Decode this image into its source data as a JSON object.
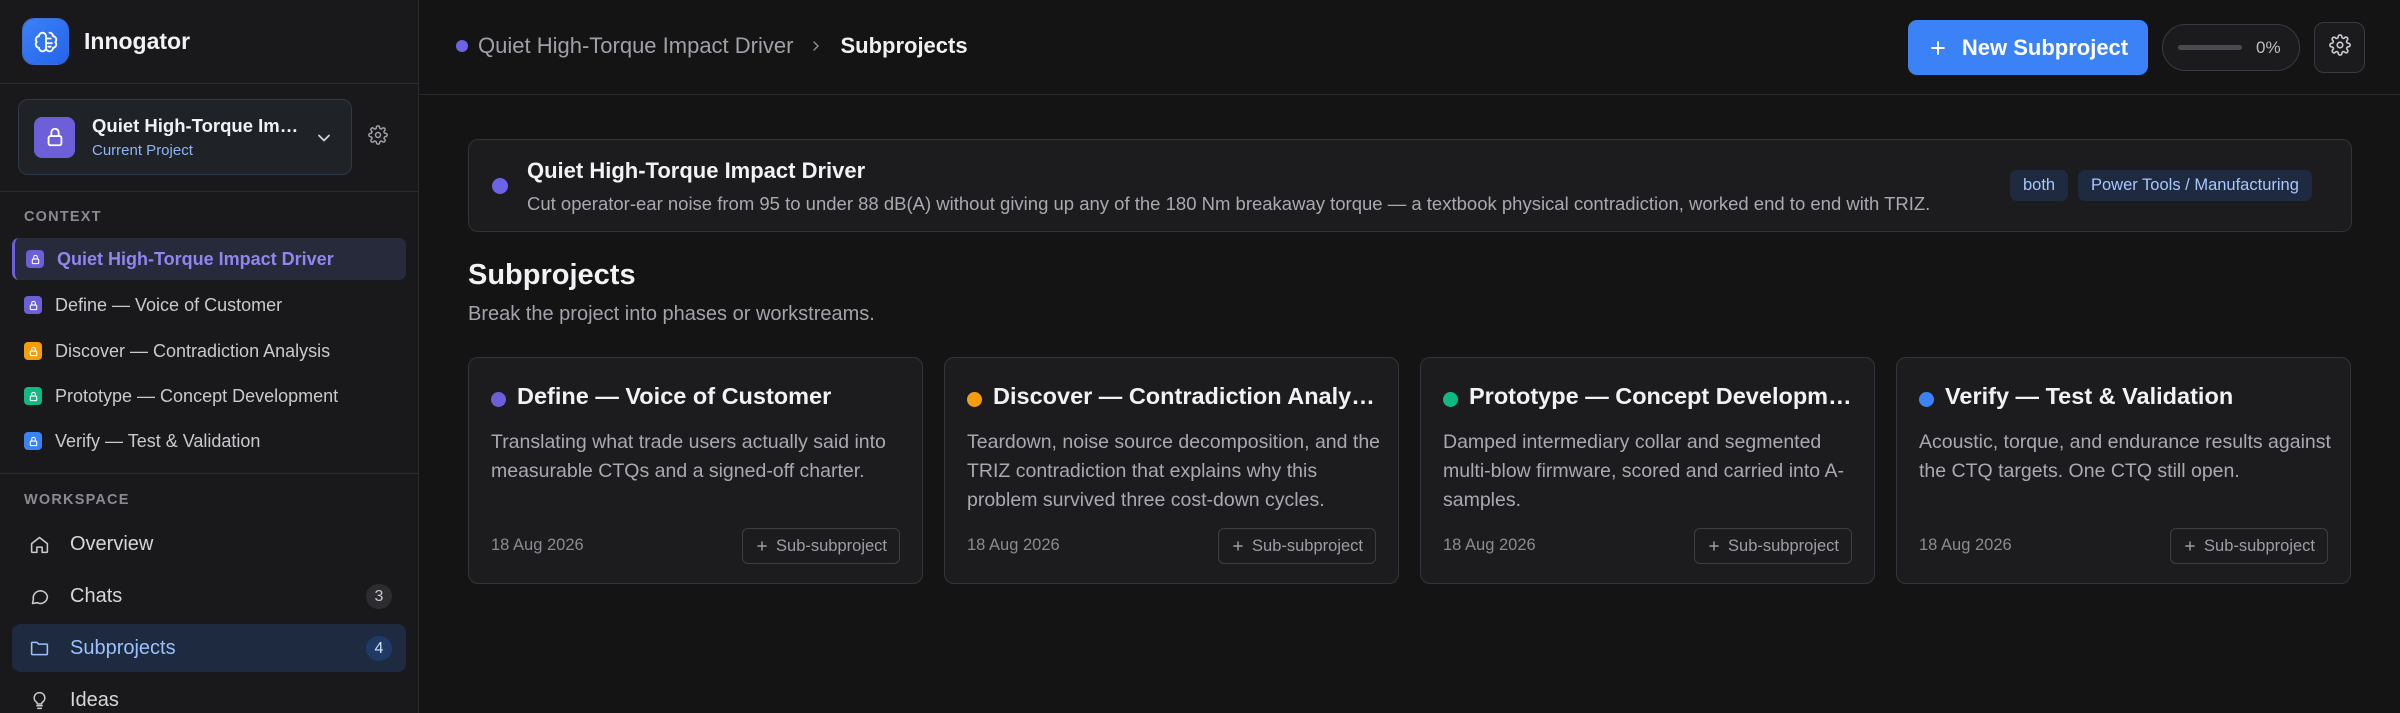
{
  "app": {
    "name": "Innogator"
  },
  "project_switcher": {
    "name": "Quiet High-Torque Impact Driver",
    "subtitle": "Current Project"
  },
  "context": {
    "label": "CONTEXT",
    "items": [
      {
        "label": "Quiet High-Torque Impact Driver",
        "color": "#6d5fd8",
        "active": true
      },
      {
        "label": "Define — Voice of Customer",
        "color": "#6d5fd8"
      },
      {
        "label": "Discover — Contradiction Analysis",
        "color": "#f59e0b"
      },
      {
        "label": "Prototype — Concept Development",
        "color": "#10b981"
      },
      {
        "label": "Verify — Test & Validation",
        "color": "#3b82f6"
      }
    ]
  },
  "workspace": {
    "label": "WORKSPACE",
    "items": [
      {
        "label": "Overview",
        "icon": "home-icon"
      },
      {
        "label": "Chats",
        "icon": "chat-icon",
        "count": "3"
      },
      {
        "label": "Subprojects",
        "icon": "folder-icon",
        "count": "4",
        "active": true
      },
      {
        "label": "Ideas",
        "icon": "lightbulb-icon"
      }
    ]
  },
  "header": {
    "breadcrumb_parent": "Quiet High-Torque Impact Driver",
    "breadcrumb_current": "Subprojects",
    "new_button": "New Subproject",
    "progress_value": 0,
    "progress_text": "0%"
  },
  "project": {
    "title": "Quiet High-Torque Impact Driver",
    "description": "Cut operator-ear noise from 95 to under 88 dB(A) without giving up any of the 180 Nm breakaway torque — a textbook physical contradiction, worked end to end with TRIZ.",
    "badges": [
      "both",
      "Power Tools / Manufacturing"
    ]
  },
  "section": {
    "title": "Subprojects",
    "subtitle": "Break the project into phases or workstreams."
  },
  "subprojects": [
    {
      "title": "Define — Voice of Customer",
      "color": "#6d5fd8",
      "description": "Translating what trade users actually said into measurable CTQs and a signed-off charter.",
      "date": "18 Aug 2026",
      "button": "Sub-subproject"
    },
    {
      "title": "Discover — Contradiction Analysis",
      "color": "#f59e0b",
      "description": "Teardown, noise source decomposition, and the TRIZ contradiction that explains why this problem survived three cost-down cycles.",
      "date": "18 Aug 2026",
      "button": "Sub-subproject"
    },
    {
      "title": "Prototype — Concept Development",
      "color": "#10b981",
      "description": "Damped intermediary collar and segmented multi-blow firmware, scored and carried into A-samples.",
      "date": "18 Aug 2026",
      "button": "Sub-subproject"
    },
    {
      "title": "Verify — Test & Validation",
      "color": "#3b82f6",
      "description": "Acoustic, torque, and endurance results against the CTQ targets. One CTQ still open.",
      "date": "18 Aug 2026",
      "button": "Sub-subproject"
    }
  ]
}
